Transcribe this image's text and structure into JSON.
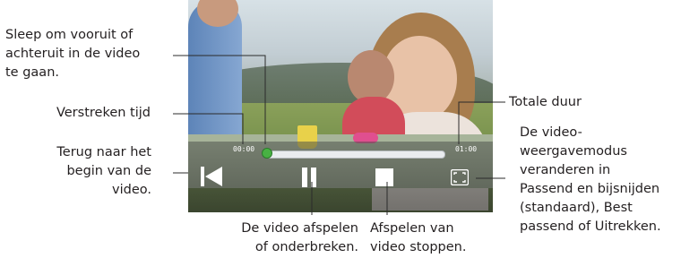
{
  "player": {
    "elapsed_time": "00:00",
    "total_time": "01:00",
    "progress": 0.0
  },
  "callouts": {
    "seek": "Sleep om vooruit of\nachteruit in de video\nte gaan.",
    "elapsed": "Verstreken tijd",
    "to_start": "Terug naar het\nbegin van de\nvideo.",
    "play_pause": "De video afspelen\nof onderbreken.",
    "stop": "Afspelen van\nvideo stoppen.",
    "total": "Totale duur",
    "display_mode": "De video-\nweergavemodus\nveranderen in\nPassend en bijsnijden\n(standaard), Best\npassend of Uitrekken."
  }
}
